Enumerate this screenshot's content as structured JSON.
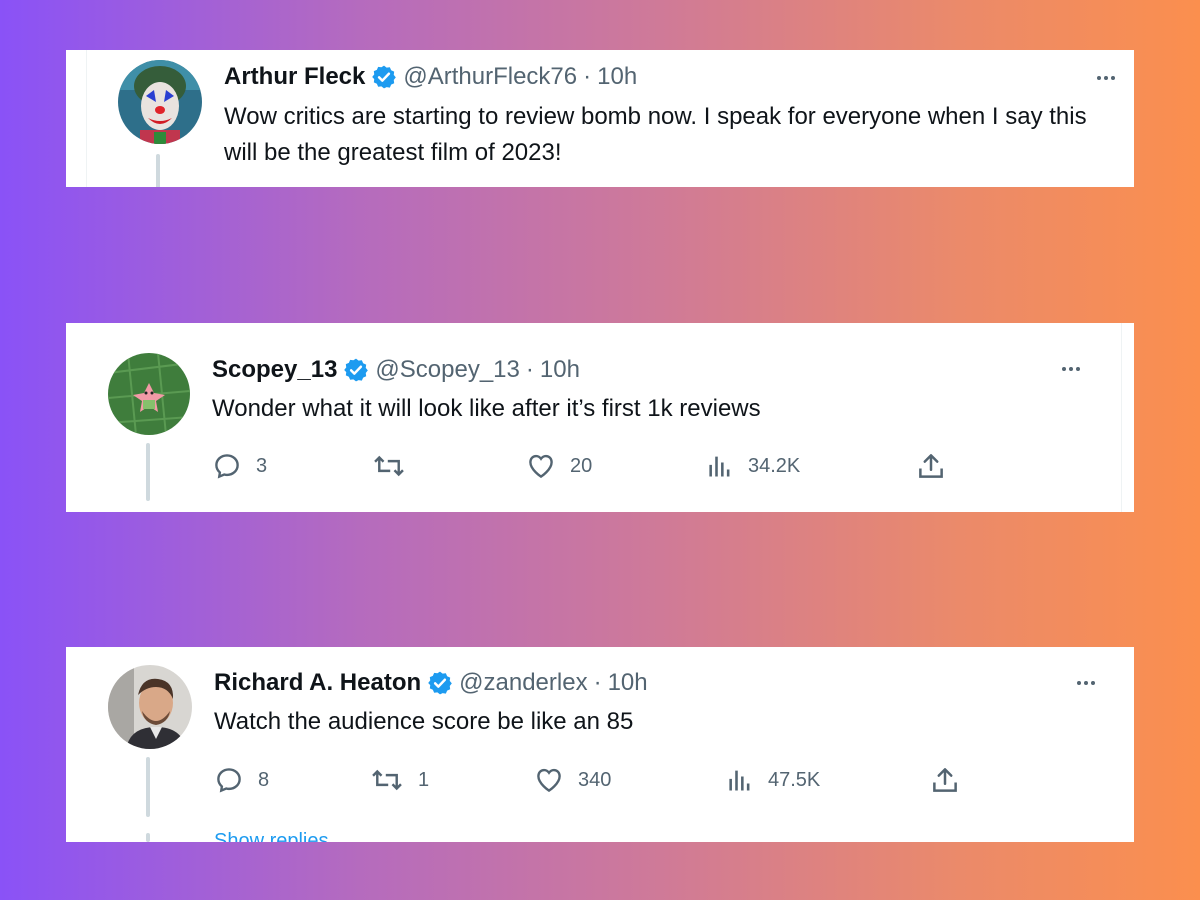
{
  "tweets": [
    {
      "avatar": "joker-avatar",
      "name": "Arthur Fleck",
      "verified": true,
      "handle": "@ArthurFleck76",
      "separator": "·",
      "time": "10h",
      "text": "Wow critics are starting to review bomb now. I speak for everyone when I say this will be the greatest film of 2023!"
    },
    {
      "avatar": "patrick-star-avatar",
      "name": "Scopey_13",
      "verified": true,
      "handle": "@Scopey_13",
      "separator": "·",
      "time": "10h",
      "text": "Wonder what it will look like after it’s first 1k reviews",
      "stats": {
        "replies": "3",
        "retweets": "",
        "likes": "20",
        "views": "34.2K"
      }
    },
    {
      "avatar": "man-portrait-avatar",
      "name": "Richard A. Heaton",
      "verified": true,
      "handle": "@zanderlex",
      "separator": "·",
      "time": "10h",
      "text": "Watch the audience score be like an 85",
      "stats": {
        "replies": "8",
        "retweets": "1",
        "likes": "340",
        "views": "47.5K"
      },
      "show_replies": "Show replies"
    }
  ],
  "colors": {
    "accent": "#1d9bf0",
    "text": "#0f1419",
    "secondary_text": "#536471",
    "thread_line": "#cfd9de",
    "gradient_start": "#8a52f7",
    "gradient_end": "#fb8f4e"
  },
  "icons": [
    "verified-badge-icon",
    "more-icon",
    "reply-icon",
    "retweet-icon",
    "like-icon",
    "views-icon",
    "share-icon"
  ]
}
